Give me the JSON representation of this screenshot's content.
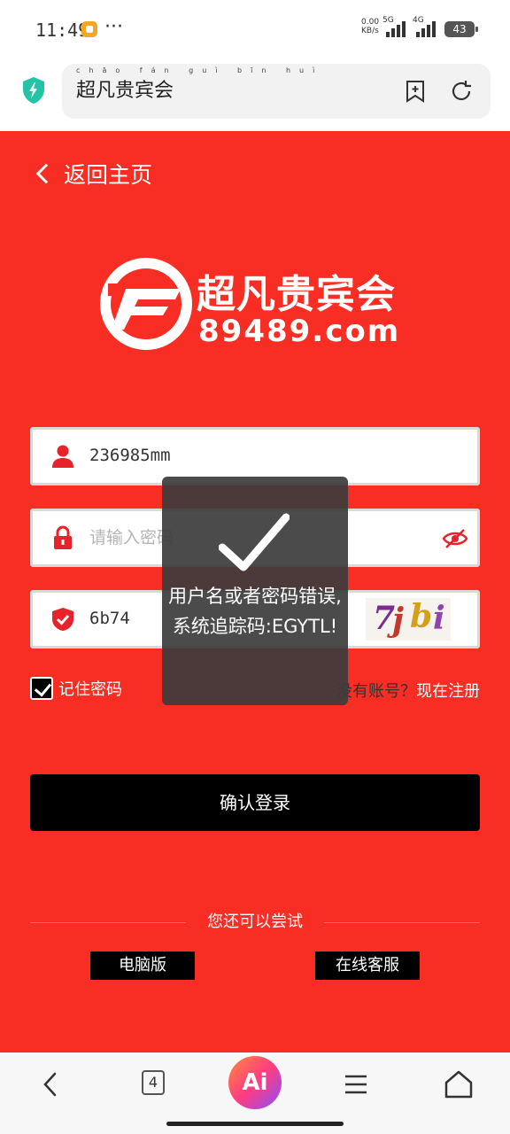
{
  "status_bar": {
    "time": "11:49",
    "more": "···",
    "net_speed": "0.00 KB/s",
    "network_1": "5G",
    "network_2": "4G",
    "battery": "43"
  },
  "browser": {
    "title": "超凡贵宾会",
    "title_pinyin": "chāo fán guì bīn huì"
  },
  "page": {
    "back_label": "返回主页",
    "logo_title": "超凡贵宾会",
    "logo_domain": "89489.com",
    "username_value": "236985mm",
    "password_placeholder": "请输入密码",
    "captcha_value": "6b74",
    "captcha_image_chars": [
      "7",
      "j",
      "b",
      "i"
    ],
    "remember_label": "记住密码",
    "register_prefix": "没有账号？",
    "register_link": "现在注册",
    "login_button": "确认登录",
    "alt_label": "您还可以尝试",
    "desktop_button": "电脑版",
    "support_button": "在线客服"
  },
  "toast": {
    "message": "用户名或者密码错误,系统追踪码:EGYTL!"
  },
  "bottom_nav": {
    "tab_count": "4",
    "ai_label": "Ai"
  },
  "colors": {
    "page_red": "#f82d24",
    "button_black": "#000000",
    "icon_red": "#e8222a"
  }
}
